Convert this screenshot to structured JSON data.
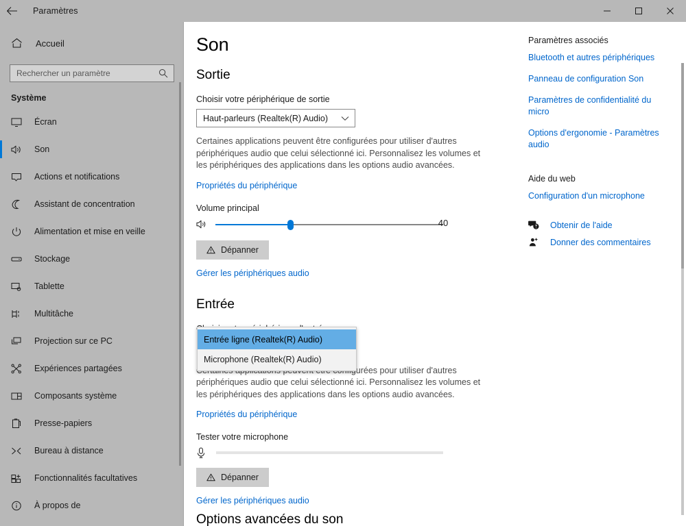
{
  "window": {
    "title": "Paramètres",
    "back_icon": "back-arrow-icon",
    "minimize_label": "Réduire",
    "maximize_label": "Agrandir",
    "close_label": "Fermer"
  },
  "sidebar": {
    "home_label": "Accueil",
    "home_icon": "home-icon",
    "search": {
      "placeholder": "Rechercher un paramètre",
      "value": "",
      "icon": "search-icon"
    },
    "section_title": "Système",
    "items": [
      {
        "label": "Écran",
        "icon": "monitor-icon",
        "selected": false
      },
      {
        "label": "Son",
        "icon": "speaker-icon",
        "selected": true
      },
      {
        "label": "Actions et notifications",
        "icon": "notification-icon",
        "selected": false
      },
      {
        "label": "Assistant de concentration",
        "icon": "moon-icon",
        "selected": false
      },
      {
        "label": "Alimentation et mise en veille",
        "icon": "power-icon",
        "selected": false
      },
      {
        "label": "Stockage",
        "icon": "drive-icon",
        "selected": false
      },
      {
        "label": "Tablette",
        "icon": "tablet-icon",
        "selected": false
      },
      {
        "label": "Multitâche",
        "icon": "multitask-icon",
        "selected": false
      },
      {
        "label": "Projection sur ce PC",
        "icon": "project-icon",
        "selected": false
      },
      {
        "label": "Expériences partagées",
        "icon": "share-icon",
        "selected": false
      },
      {
        "label": "Composants système",
        "icon": "components-icon",
        "selected": false
      },
      {
        "label": "Presse-papiers",
        "icon": "clipboard-icon",
        "selected": false
      },
      {
        "label": "Bureau à distance",
        "icon": "remote-desktop-icon",
        "selected": false
      },
      {
        "label": "Fonctionnalités facultatives",
        "icon": "features-icon",
        "selected": false
      },
      {
        "label": "À propos de",
        "icon": "info-icon",
        "selected": false
      }
    ]
  },
  "main": {
    "page_title": "Son",
    "output": {
      "heading": "Sortie",
      "device_label": "Choisir votre périphérique de sortie",
      "device_value": "Haut-parleurs (Realtek(R) Audio)",
      "description": "Certaines applications peuvent être configurées pour utiliser d'autres périphériques audio que celui sélectionné ici. Personnalisez les volumes et les périphériques des applications dans les options audio avancées.",
      "properties_link": "Propriétés du périphérique",
      "volume_label": "Volume principal",
      "volume_value": "40",
      "volume_icon": "speaker-icon",
      "troubleshoot_label": "Dépanner",
      "troubleshoot_icon": "warning-icon",
      "manage_link": "Gérer les périphériques audio"
    },
    "input": {
      "heading": "Entrée",
      "device_label": "Choisir votre périphérique d'entrée",
      "description": "Certaines applications peuvent être configurées pour utiliser d'autres périphériques audio que celui sélectionné ici. Personnalisez les volumes et les périphériques des applications dans les options audio avancées.",
      "properties_link": "Propriétés du périphérique",
      "test_label": "Tester votre microphone",
      "test_icon": "microphone-icon",
      "test_level": 0,
      "troubleshoot_label": "Dépanner",
      "troubleshoot_icon": "warning-icon",
      "manage_link": "Gérer les périphériques audio",
      "dropdown_open": true,
      "dropdown_options": [
        {
          "label": "Entrée ligne (Realtek(R) Audio)",
          "highlighted": true
        },
        {
          "label": "Microphone (Realtek(R) Audio)",
          "highlighted": false
        }
      ]
    },
    "advanced_heading": "Options avancées du son"
  },
  "rail": {
    "related_heading": "Paramètres associés",
    "related_links": [
      "Bluetooth et autres périphériques",
      "Panneau de configuration Son",
      "Paramètres de confidentialité du micro",
      "Options d'ergonomie - Paramètres audio"
    ],
    "web_heading": "Aide du web",
    "web_links": [
      "Configuration d'un microphone"
    ],
    "footer": [
      {
        "label": "Obtenir de l'aide",
        "icon": "help-icon"
      },
      {
        "label": "Donner des commentaires",
        "icon": "feedback-icon"
      }
    ]
  },
  "colors": {
    "accent": "#0078d7",
    "link": "#0066cc",
    "highlight": "#63ade5",
    "chrome": "#b8b8b8"
  }
}
